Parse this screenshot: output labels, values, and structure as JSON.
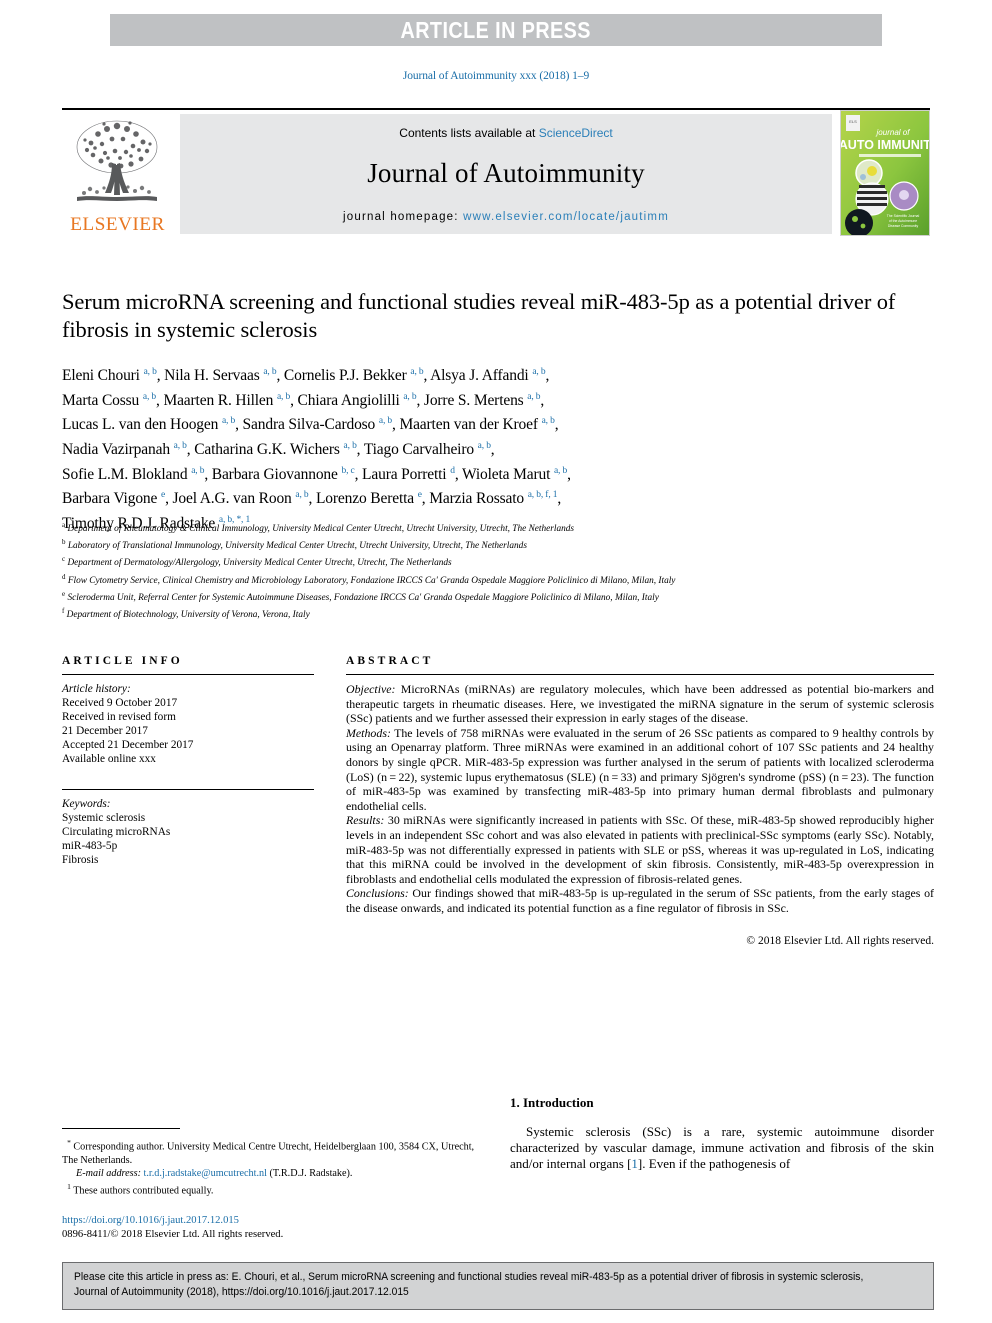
{
  "press_banner": {
    "text": "ARTICLE IN PRESS",
    "background": "#bfc1c3",
    "text_color": "#ffffff"
  },
  "running_head": {
    "text": "Journal of Autoimmunity xxx (2018) 1–9",
    "color": "#1a6ea8"
  },
  "masthead": {
    "contents_prefix": "Contents lists available at ",
    "contents_link": "ScienceDirect",
    "journal_name": "Journal of Autoimmunity",
    "homepage_prefix": "journal homepage: ",
    "homepage_url": "www.elsevier.com/locate/jautimm",
    "publisher_wordmark": "ELSEVIER",
    "publisher_color": "#e87722",
    "link_color": "#2b7fb8",
    "cover_title_line1": "journal of",
    "cover_title_line2": "AUTO IMMUNITY"
  },
  "title": "Serum microRNA screening and functional studies reveal miR-483-5p as a potential driver of fibrosis in systemic sclerosis",
  "authors_html": "Eleni Chouri <sup>a, b</sup>, Nila H. Servaas <sup>a, b</sup>, Cornelis P.J. Bekker <sup>a, b</sup>, Alsya J. Affandi <sup>a, b</sup>,<br>Marta Cossu <sup>a, b</sup>, Maarten R. Hillen <sup>a, b</sup>, Chiara Angiolilli <sup>a, b</sup>, Jorre S. Mertens <sup>a, b</sup>,<br>Lucas L. van den Hoogen <sup>a, b</sup>, Sandra Silva-Cardoso <sup>a, b</sup>, Maarten van der Kroef <sup>a, b</sup>,<br>Nadia Vazirpanah <sup>a, b</sup>, Catharina G.K. Wichers <sup>a, b</sup>, Tiago Carvalheiro <sup>a, b</sup>,<br>Sofie L.M. Blokland <sup>a, b</sup>, Barbara Giovannone <sup>b, c</sup>, Laura Porretti <sup>d</sup>, Wioleta Marut <sup>a, b</sup>,<br>Barbara Vigone <sup>e</sup>, Joel A.G. van Roon <sup>a, b</sup>, Lorenzo Beretta <sup>e</sup>, Marzia Rossato <sup>a, b, f, 1</sup>,<br>Timothy R.D.J. Radstake <sup>a, b, *, 1</sup>",
  "affiliations": [
    {
      "marker": "a",
      "text": "Department of Rheumatology & Clinical Immunology, University Medical Center Utrecht, Utrecht University, Utrecht, The Netherlands"
    },
    {
      "marker": "b",
      "text": "Laboratory of Translational Immunology, University Medical Center Utrecht, Utrecht University, Utrecht, The Netherlands"
    },
    {
      "marker": "c",
      "text": "Department of Dermatology/Allergology, University Medical Center Utrecht, Utrecht, The Netherlands"
    },
    {
      "marker": "d",
      "text": "Flow Cytometry Service, Clinical Chemistry and Microbiology Laboratory, Fondazione IRCCS Ca' Granda Ospedale Maggiore Policlinico di Milano, Milan, Italy"
    },
    {
      "marker": "e",
      "text": "Scleroderma Unit, Referral Center for Systemic Autoimmune Diseases, Fondazione IRCCS Ca' Granda Ospedale Maggiore Policlinico di Milano, Milan, Italy"
    },
    {
      "marker": "f",
      "text": "Department of Biotechnology, University of Verona, Verona, Italy"
    }
  ],
  "article_info": {
    "heading": "ARTICLE INFO",
    "history_label": "Article history:",
    "history_lines": [
      "Received 9 October 2017",
      "Received in revised form",
      "21 December 2017",
      "Accepted 21 December 2017",
      "Available online xxx"
    ],
    "keywords_label": "Keywords:",
    "keywords": [
      "Systemic sclerosis",
      "Circulating microRNAs",
      "miR-483-5p",
      "Fibrosis"
    ]
  },
  "abstract": {
    "heading": "ABSTRACT",
    "sections": [
      {
        "lead": "Objective:",
        "text": " MicroRNAs (miRNAs) are regulatory molecules, which have been addressed as potential bio-markers and therapeutic targets in rheumatic diseases. Here, we investigated the miRNA signature in the serum of systemic sclerosis (SSc) patients and we further assessed their expression in early stages of the disease."
      },
      {
        "lead": "Methods:",
        "text": " The levels of 758 miRNAs were evaluated in the serum of 26 SSc patients as compared to 9 healthy controls by using an Openarray platform. Three miRNAs were examined in an additional cohort of 107 SSc patients and 24 healthy donors by single qPCR. MiR-483-5p expression was further analysed in the serum of patients with localized scleroderma (LoS) (n = 22), systemic lupus erythematosus (SLE) (n = 33) and primary Sjögren's syndrome (pSS) (n = 23). The function of miR-483-5p was examined by transfecting miR-483-5p into primary human dermal fibroblasts and pulmonary endothelial cells."
      },
      {
        "lead": "Results:",
        "text": " 30 miRNAs were significantly increased in patients with SSc. Of these, miR-483-5p showed reproducibly higher levels in an independent SSc cohort and was also elevated in patients with preclinical-SSc symptoms (early SSc). Notably, miR-483-5p was not differentially expressed in patients with SLE or pSS, whereas it was up-regulated in LoS, indicating that this miRNA could be involved in the development of skin fibrosis. Consistently, miR-483-5p overexpression in fibroblasts and endothelial cells modulated the expression of fibrosis-related genes."
      },
      {
        "lead": "Conclusions:",
        "text": " Our findings showed that miR-483-5p is up-regulated in the serum of SSc patients, from the early stages of the disease onwards, and indicated its potential function as a fine regulator of fibrosis in SSc."
      }
    ],
    "copyright": "© 2018 Elsevier Ltd. All rights reserved."
  },
  "introduction": {
    "heading": "1. Introduction",
    "paragraph_part1": "Systemic sclerosis (SSc) is a rare, systemic autoimmune disorder characterized by vascular damage, immune activation and fibrosis of the skin and/or internal organs [",
    "reference": "1",
    "paragraph_part2": "]. Even if the pathogenesis of"
  },
  "footnotes": {
    "corresponding_marker": "*",
    "corresponding_text": " Corresponding author. University Medical Centre Utrecht, Heidelberglaan 100, 3584 CX, Utrecht, The Netherlands.",
    "email_label": "E-mail address:",
    "email": "t.r.d.j.radstake@umcutrecht.nl",
    "email_suffix": " (T.R.D.J. Radstake).",
    "equal_marker": "1",
    "equal_text": " These authors contributed equally.",
    "doi": "https://doi.org/10.1016/j.jaut.2017.12.015",
    "issn_line": "0896-8411/© 2018 Elsevier Ltd. All rights reserved."
  },
  "citation_footer": {
    "text": "Please cite this article in press as: E. Chouri, et al., Serum microRNA screening and functional studies reveal miR-483-5p as a potential driver of fibrosis in systemic sclerosis, Journal of Autoimmunity (2018), https://doi.org/10.1016/j.jaut.2017.12.015",
    "background": "#d2d3d4"
  }
}
